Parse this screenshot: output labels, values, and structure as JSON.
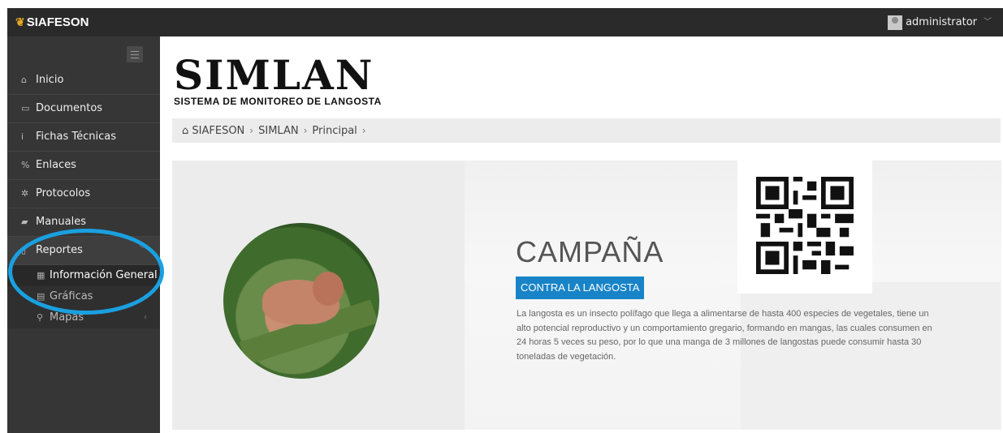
{
  "topbar": {
    "brand": "SIAFESON",
    "brand_icon": "leaf-logo-icon",
    "user_name": "administrator",
    "user_chevron": "chevron-down-icon"
  },
  "sidebar": {
    "toggle_icon": "hamburger-icon",
    "items": [
      {
        "label": "Inicio",
        "icon": "home-icon"
      },
      {
        "label": "Documentos",
        "icon": "folder-icon"
      },
      {
        "label": "Fichas Técnicas",
        "icon": "info-icon"
      },
      {
        "label": "Enlaces",
        "icon": "link-icon"
      },
      {
        "label": "Protocolos",
        "icon": "gear-icon"
      },
      {
        "label": "Manuales",
        "icon": "book-icon"
      },
      {
        "label": "Reportes",
        "icon": "file-icon",
        "expanded": true
      }
    ],
    "subitems": [
      {
        "label": "Información General",
        "icon": "table-icon",
        "selected": true
      },
      {
        "label": "Gráficas",
        "icon": "chart-icon"
      },
      {
        "label": "Mapas",
        "icon": "map-marker-icon"
      }
    ]
  },
  "logo": {
    "title": "SIMLAN",
    "subtitle": "SISTEMA DE MONITOREO DE LANGOSTA"
  },
  "breadcrumb": {
    "items": [
      "SIAFESON",
      "SIMLAN",
      "Principal"
    ],
    "home_icon": "home-icon"
  },
  "banner": {
    "heading": "CAMPAÑA",
    "tag": "CONTRA LA LANGOSTA",
    "description": "La langosta es un insecto polífago que llega a alimentarse de hasta 400 especies de vegetales, tiene un alto potencial reproductivo y un comportamiento gregario, formando en mangas, las cuales consumen en 24 horas 5 veces su peso, por lo que una manga de 3 millones de langostas puede consumir hasta 30 toneladas de vegetación."
  },
  "colors": {
    "topbar": "#2a2a2a",
    "sidebar": "#363636",
    "accent": "#1884c7",
    "highlight": "#1aa0e0"
  }
}
